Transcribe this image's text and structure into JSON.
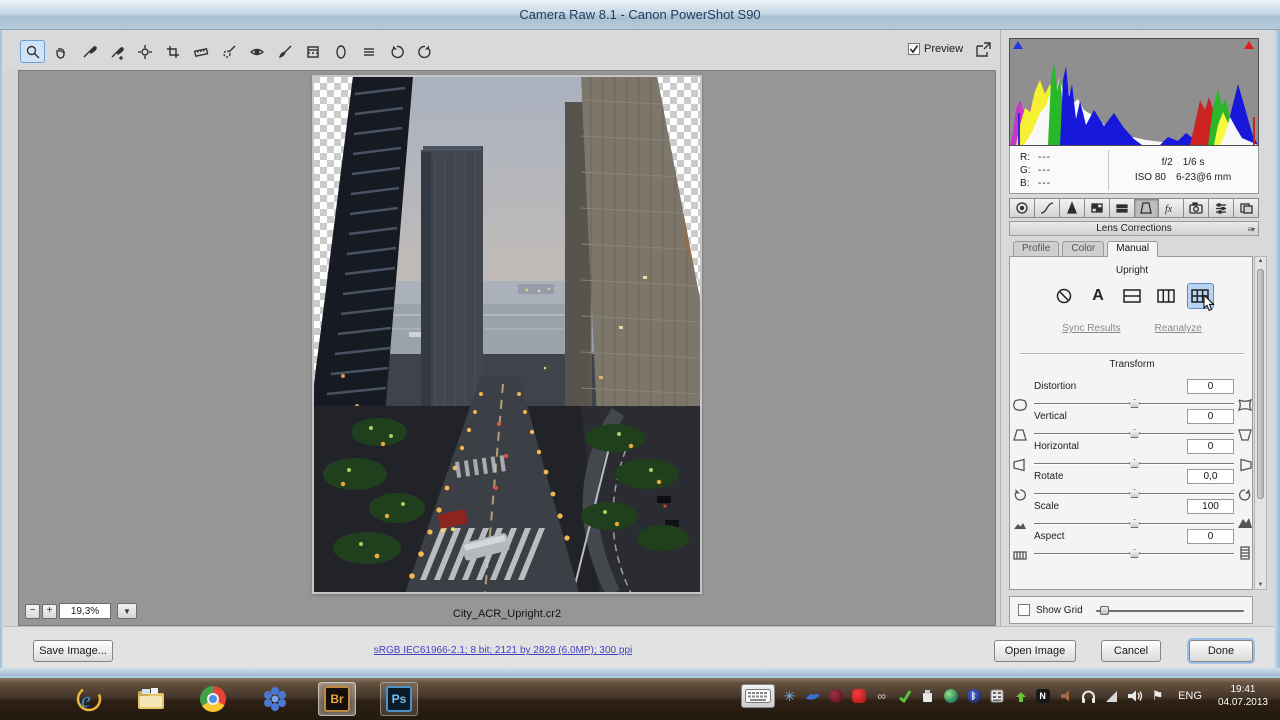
{
  "window": {
    "title": "Camera Raw 8.1  -  Canon PowerShot S90"
  },
  "toolbar": {
    "preview_label": "Preview",
    "active_tool": "Zoom",
    "tools": [
      "Zoom",
      "Hand",
      "White Balance",
      "Color Sampler",
      "Targeted Adjustment",
      "Crop",
      "Straighten",
      "Spot Removal",
      "Red Eye Removal",
      "Adjustment Brush",
      "Graduated Filter",
      "Radial Filter",
      "Preferences",
      "Rotate Left",
      "Rotate Right"
    ]
  },
  "histogram": {
    "r_label": "R:",
    "g_label": "G:",
    "b_label": "B:",
    "r_value": "---",
    "g_value": "---",
    "b_value": "---",
    "aperture": "f/2",
    "shutter": "1/6 s",
    "iso": "ISO 80",
    "lens": "6-23@6 mm"
  },
  "panel": {
    "title": "Lens Corrections",
    "tabs": [
      {
        "label": "Profile"
      },
      {
        "label": "Color"
      },
      {
        "label": "Manual"
      }
    ],
    "active_tab": "Manual",
    "upright": {
      "label": "Upright",
      "selected": "Full",
      "sync_link": "Sync Results",
      "reanalyze_link": "Reanalyze"
    },
    "transform": {
      "label": "Transform",
      "sliders": [
        {
          "label": "Distortion",
          "value": "0"
        },
        {
          "label": "Vertical",
          "value": "0"
        },
        {
          "label": "Horizontal",
          "value": "0"
        },
        {
          "label": "Rotate",
          "value": "0,0"
        },
        {
          "label": "Scale",
          "value": "100"
        },
        {
          "label": "Aspect",
          "value": "0"
        }
      ]
    },
    "show_grid_label": "Show Grid",
    "show_grid_checked": false
  },
  "canvas": {
    "zoom_value": "19,3%",
    "filename": "City_ACR_Upright.cr2"
  },
  "footer": {
    "save_button": "Save Image...",
    "workflow_link": "sRGB IEC61966-2.1; 8 bit; 2121 by 2828 (6.0MP); 300 ppi",
    "open_button": "Open Image",
    "cancel_button": "Cancel",
    "done_button": "Done"
  },
  "taskbar": {
    "language": "ENG",
    "time": "19:41",
    "date": "04.07.2013"
  },
  "colors": {
    "tool_selection": "#cfe4f8",
    "upright_selection": "#b9d4f2",
    "link_blue": "#4343c4",
    "canvas_gray": "#969696",
    "histogram_bg": "#8f8f8f"
  }
}
